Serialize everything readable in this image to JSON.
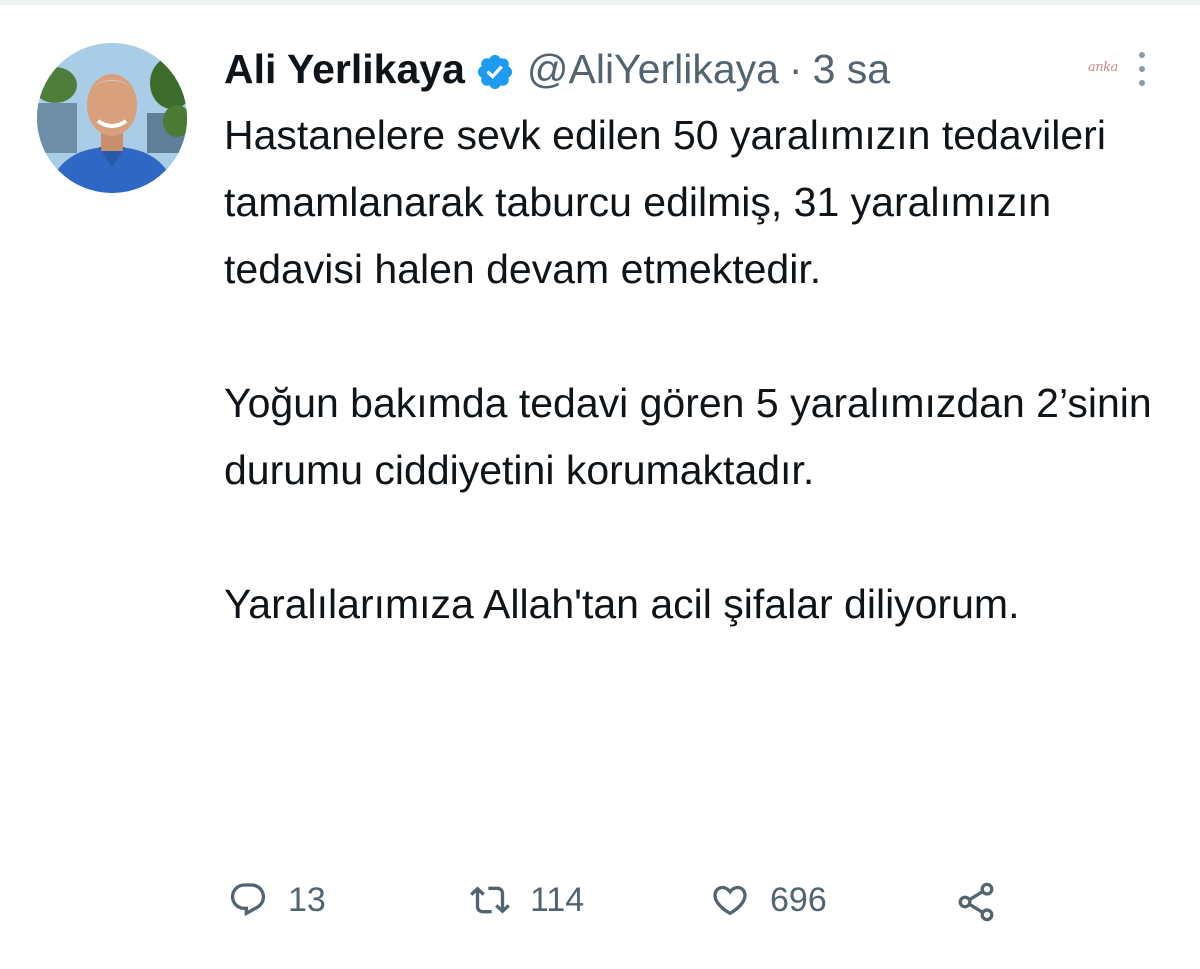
{
  "tweet": {
    "author_name": "Ali Yerlikaya",
    "verified": true,
    "handle": "@AliYerlikaya",
    "separator": "·",
    "time": "3 sa",
    "watermark": "anka",
    "paragraphs": [
      "Hastanelere sevk edilen 50 yaralımızın tedavileri tamamlanarak taburcu edilmiş, 31 yaralımızın tedavisi halen devam etmektedir.",
      "Yoğun bakımda tedavi gören 5 yaralımızdan 2’sinin durumu ciddiyetini korumaktadır.",
      "Yaralılarımıza Allah'tan acil şifalar diliyorum."
    ],
    "actions": {
      "reply_count": "13",
      "retweet_count": "114",
      "like_count": "696"
    }
  },
  "colors": {
    "text": "#0f1419",
    "secondary": "#536471",
    "verified_badge": "#1d9bf0",
    "background": "#ffffff"
  },
  "icons": {
    "verified": "verified-badge-icon",
    "more": "more-vertical-icon",
    "reply": "reply-icon",
    "retweet": "retweet-icon",
    "like": "heart-icon",
    "share": "share-icon"
  }
}
